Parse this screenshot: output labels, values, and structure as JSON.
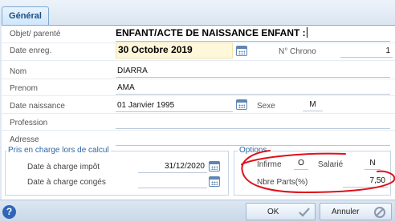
{
  "tabs": [
    {
      "label": "Général"
    }
  ],
  "form": {
    "objet_label": "Objet/ parenté",
    "objet_value": "ENFANT/ACTE DE NAISSANCE ENFANT :",
    "date_enreg_label": "Date enreg.",
    "date_enreg_value": "30 Octobre 2019",
    "chrono_label": "N° Chrono",
    "chrono_value": "1",
    "nom_label": "Nom",
    "nom_value": "DIARRA",
    "prenom_label": "Prenom",
    "prenom_value": "AMA",
    "naissance_label": "Date naissance",
    "naissance_value": "01 Janvier 1995",
    "sexe_label": "Sexe",
    "sexe_value": "M",
    "profession_label": "Profession",
    "profession_value": "",
    "adresse_label": "Adresse",
    "adresse_value": ""
  },
  "prise_en_charge": {
    "legend": "Pris en charge lors de calcul",
    "impot_label": "Date à charge impôt",
    "impot_value": "31/12/2020",
    "conges_label": "Date à charge congés",
    "conges_value": ""
  },
  "options": {
    "legend": "Options",
    "infirme_label": "Infirme",
    "infirme_value": "O",
    "salarie_label": "Salarié",
    "salarie_value": "N",
    "parts_label": "Nbre Parts(%)",
    "parts_value": "7,50"
  },
  "footer": {
    "help_icon": "?",
    "ok_label": "OK",
    "cancel_label": "Annuler"
  },
  "colors": {
    "accent": "#2f67a6",
    "annotation": "#e0101a"
  }
}
